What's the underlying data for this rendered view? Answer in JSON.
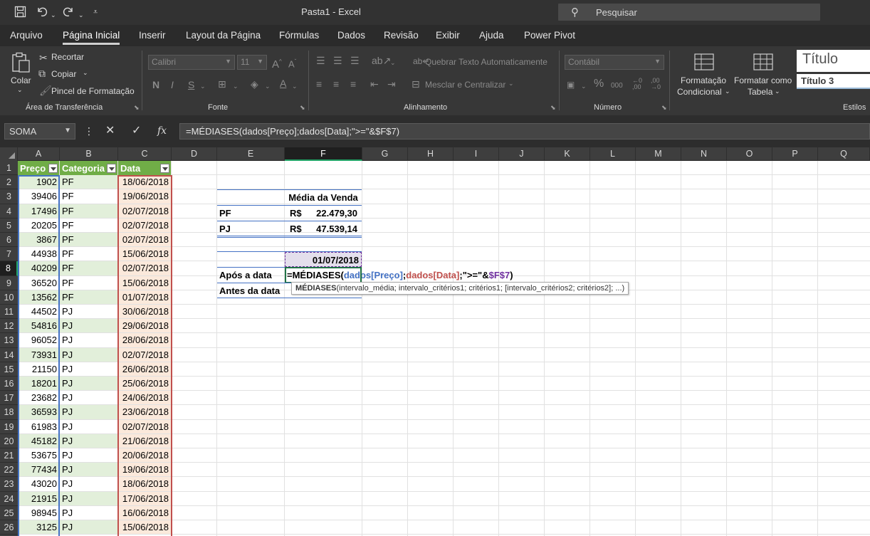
{
  "window": {
    "title": "Pasta1  -  Excel",
    "search_placeholder": "Pesquisar"
  },
  "menu": {
    "tabs": [
      "Arquivo",
      "Página Inicial",
      "Inserir",
      "Layout da Página",
      "Fórmulas",
      "Dados",
      "Revisão",
      "Exibir",
      "Ajuda",
      "Power Pivot"
    ],
    "active": "Página Inicial"
  },
  "ribbon": {
    "clipboard": {
      "label": "Área de Transferência",
      "paste": "Colar",
      "cut": "Recortar",
      "copy": "Copiar",
      "format_painter": "Pincel de Formatação"
    },
    "font": {
      "label": "Fonte",
      "font_name": "Calibri",
      "font_size": "11"
    },
    "alignment": {
      "label": "Alinhamento",
      "wrap": "Quebrar Texto Automaticamente",
      "merge": "Mesclar e Centralizar"
    },
    "number": {
      "label": "Número",
      "format": "Contábil"
    },
    "styles": {
      "label": "Estilos",
      "conditional_1": "Formatação",
      "conditional_2": "Condicional",
      "table_1": "Formatar como",
      "table_2": "Tabela",
      "style_title": "Título",
      "style_title3": "Título 3"
    }
  },
  "formula_bar": {
    "name_box": "SOMA",
    "formula": "=MÉDIASES(dados[Preço];dados[Data];\">=\"&$F$7)"
  },
  "grid": {
    "columns": [
      "A",
      "B",
      "C",
      "D",
      "E",
      "F",
      "G",
      "H",
      "I",
      "J",
      "K",
      "L",
      "M",
      "N",
      "O",
      "P",
      "Q"
    ],
    "rows": [
      "1",
      "2",
      "3",
      "4",
      "5",
      "6",
      "7",
      "8",
      "9",
      "10",
      "11",
      "12",
      "13",
      "14",
      "15",
      "16",
      "17",
      "18",
      "19",
      "20",
      "21",
      "22",
      "23",
      "24",
      "25",
      "26"
    ],
    "selected_column": "F",
    "selected_row": "8",
    "table_headers": [
      "Preço",
      "Categoria",
      "Data"
    ],
    "table_rows": [
      [
        "1902",
        "PF",
        "18/06/2018"
      ],
      [
        "39406",
        "PF",
        "19/06/2018"
      ],
      [
        "17496",
        "PF",
        "02/07/2018"
      ],
      [
        "20205",
        "PF",
        "02/07/2018"
      ],
      [
        "3867",
        "PF",
        "02/07/2018"
      ],
      [
        "44938",
        "PF",
        "15/06/2018"
      ],
      [
        "40209",
        "PF",
        "02/07/2018"
      ],
      [
        "36520",
        "PF",
        "15/06/2018"
      ],
      [
        "13562",
        "PF",
        "01/07/2018"
      ],
      [
        "44502",
        "PJ",
        "30/06/2018"
      ],
      [
        "54816",
        "PJ",
        "29/06/2018"
      ],
      [
        "96052",
        "PJ",
        "28/06/2018"
      ],
      [
        "73931",
        "PJ",
        "02/07/2018"
      ],
      [
        "21150",
        "PJ",
        "26/06/2018"
      ],
      [
        "18201",
        "PJ",
        "25/06/2018"
      ],
      [
        "23682",
        "PJ",
        "24/06/2018"
      ],
      [
        "36593",
        "PJ",
        "23/06/2018"
      ],
      [
        "61983",
        "PJ",
        "02/07/2018"
      ],
      [
        "45182",
        "PJ",
        "21/06/2018"
      ],
      [
        "53675",
        "PJ",
        "20/06/2018"
      ],
      [
        "77434",
        "PJ",
        "19/06/2018"
      ],
      [
        "43020",
        "PJ",
        "18/06/2018"
      ],
      [
        "21915",
        "PJ",
        "17/06/2018"
      ],
      [
        "98945",
        "PJ",
        "16/06/2018"
      ],
      [
        "3125",
        "PJ",
        "15/06/2018"
      ]
    ],
    "summary": {
      "header": "Média da Venda",
      "pf_label": "PF",
      "pf_currency": "R$",
      "pf_value": "22.479,30",
      "pj_label": "PJ",
      "pj_currency": "R$",
      "pj_value": "47.539,14",
      "date_value": "01/07/2018",
      "after_label": "Após a data",
      "before_label": "Antes da data",
      "edit": {
        "a": "=MÉDIASES(",
        "b": "dados[Preço]",
        "c": ";",
        "d": "dados[Data]",
        "e": ";\">=\"&",
        "f": "$F$7",
        "g": ")"
      }
    },
    "tooltip": {
      "fn": "MÉDIASES",
      "args": "(intervalo_média; intervalo_critérios1; critérios1; [intervalo_critérios2; critérios2]; ...)"
    }
  },
  "colors": {
    "table_header": "#70ad47",
    "band": "#e2efda",
    "ref_blue": "#4472c4",
    "ref_red": "#c0504d",
    "ref_purple": "#7030a0",
    "accent": "#21a366"
  }
}
